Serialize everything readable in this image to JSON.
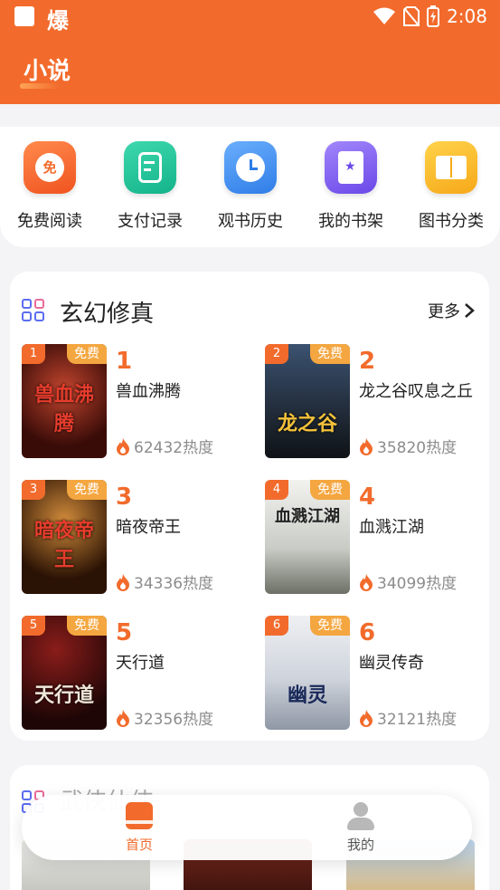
{
  "status_bar": {
    "time": "2:08",
    "app_glyph": "爆"
  },
  "header": {
    "title": "小说"
  },
  "quick_actions": [
    {
      "label": "免费阅读",
      "icon": "free-read-icon",
      "icon_text": "免",
      "color": "#f46a2d"
    },
    {
      "label": "支付记录",
      "icon": "payment-record-icon",
      "color": "#1fc39a"
    },
    {
      "label": "观书历史",
      "icon": "history-clock-icon",
      "color": "#3d8ef5"
    },
    {
      "label": "我的书架",
      "icon": "bookshelf-icon",
      "color": "#7d5df0"
    },
    {
      "label": "图书分类",
      "icon": "book-category-icon",
      "color": "#f7b92a"
    }
  ],
  "section": {
    "title": "玄幻修真",
    "more": "更多",
    "books": [
      {
        "rank": "1",
        "name": "兽血沸腾",
        "heat": "62432热度",
        "free": "免费",
        "cover_text": "兽血沸腾",
        "cover_color": "#5a1a12"
      },
      {
        "rank": "2",
        "name": "龙之谷叹息之丘",
        "heat": "35820热度",
        "free": "免费",
        "cover_text": "龙之谷",
        "cover_color": "#2a3a55"
      },
      {
        "rank": "3",
        "name": "暗夜帝王",
        "heat": "34336热度",
        "free": "免费",
        "cover_text": "暗夜帝王",
        "cover_color": "#3a1a08"
      },
      {
        "rank": "4",
        "name": "血溅江湖",
        "heat": "34099热度",
        "free": "免费",
        "cover_text": "血溅江湖",
        "cover_color": "#d8d8d2"
      },
      {
        "rank": "5",
        "name": "天行道",
        "heat": "32356热度",
        "free": "免费",
        "cover_text": "天行道",
        "cover_color": "#4a0e10"
      },
      {
        "rank": "6",
        "name": "幽灵传奇",
        "heat": "32121热度",
        "free": "免费",
        "cover_text": "幽灵",
        "cover_color": "#e4e6ea"
      }
    ]
  },
  "section2": {
    "title": "武侠仙侠"
  },
  "tabbar": [
    {
      "label": "首页",
      "icon": "home-book-icon",
      "active": true
    },
    {
      "label": "我的",
      "icon": "profile-icon",
      "active": false
    }
  ]
}
